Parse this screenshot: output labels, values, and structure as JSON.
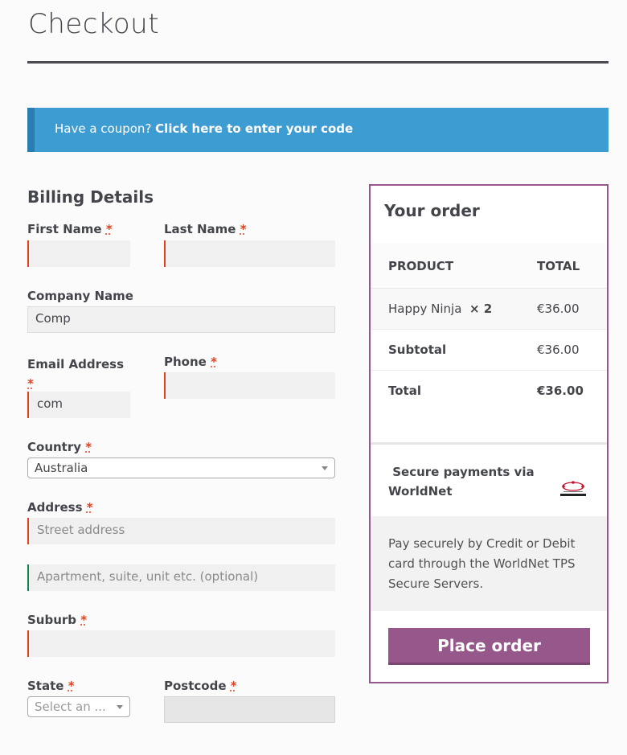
{
  "page": {
    "title": "Checkout"
  },
  "coupon": {
    "text": "Have a coupon? ",
    "link": "Click here to enter your code"
  },
  "billing": {
    "title": "Billing Details",
    "required_mark": "*",
    "first_name": {
      "label": "First Name",
      "value": ""
    },
    "last_name": {
      "label": "Last Name",
      "value": ""
    },
    "company": {
      "label": "Company Name",
      "value": "Comp"
    },
    "email": {
      "label": "Email Address",
      "value": "com"
    },
    "phone": {
      "label": "Phone",
      "value": ""
    },
    "country": {
      "label": "Country",
      "value": "Australia"
    },
    "address": {
      "label": "Address",
      "placeholder_1": "Street address",
      "placeholder_2": "Apartment, suite, unit etc. (optional)"
    },
    "suburb": {
      "label": "Suburb",
      "value": ""
    },
    "state": {
      "label": "State",
      "placeholder": "Select an ..."
    },
    "postcode": {
      "label": "Postcode",
      "value": ""
    }
  },
  "order": {
    "title": "Your order",
    "col_product": "PRODUCT",
    "col_total": "TOTAL",
    "item": {
      "name": "Happy Ninja",
      "qty": "× 2",
      "total": "€36.00"
    },
    "subtotal": {
      "label": "Subtotal",
      "value": "€36.00"
    },
    "total": {
      "label": "Total",
      "value": "€36.00"
    },
    "payment": {
      "title": "Secure payments via WorldNet",
      "description": "Pay securely by Credit or Debit card through the WorldNet TPS Secure Servers.",
      "logo_icon": "worldnet-logo-icon"
    },
    "place_order": "Place order"
  },
  "colors": {
    "accent": "#96588a",
    "info": "#3d9cd2",
    "error": "#e2401c",
    "success": "#0f834d"
  }
}
